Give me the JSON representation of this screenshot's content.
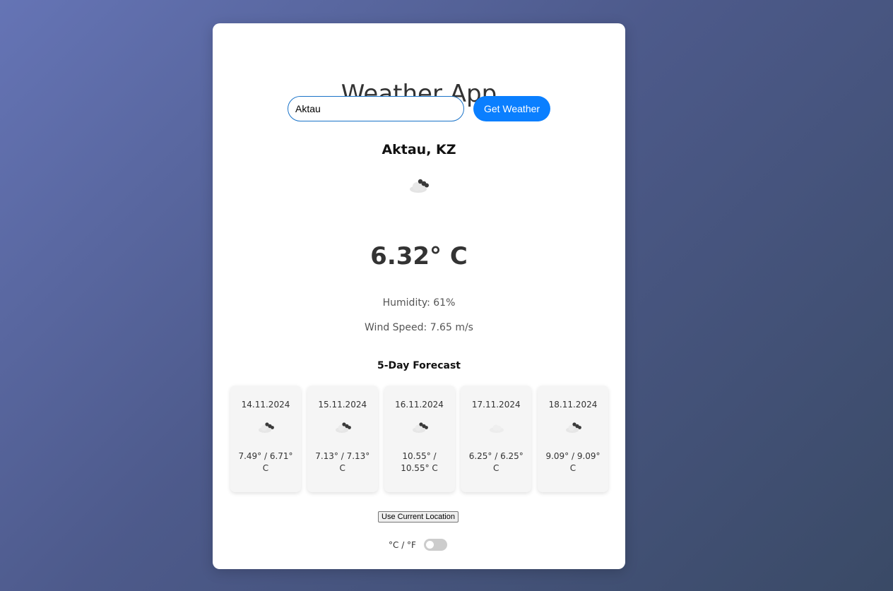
{
  "app": {
    "title": "Weather App"
  },
  "search": {
    "value": "Aktau",
    "button_label": "Get Weather"
  },
  "current": {
    "location": "Aktau, KZ",
    "icon": "cloud-icon",
    "temperature": "6.32° C",
    "humidity": "Humidity: 61%",
    "wind_speed": "Wind Speed: 7.65 m/s"
  },
  "forecast": {
    "title": "5-Day Forecast",
    "days": [
      {
        "date": "14.11.2024",
        "icon": "cloud-icon",
        "temp_line1": "7.49° / 6.71°",
        "temp_line2": "C"
      },
      {
        "date": "15.11.2024",
        "icon": "cloud-icon",
        "temp_line1": "7.13° / 7.13°",
        "temp_line2": "C"
      },
      {
        "date": "16.11.2024",
        "icon": "cloud-icon",
        "temp_line1": "10.55° /",
        "temp_line2": "10.55° C"
      },
      {
        "date": "17.11.2024",
        "icon": "cloud-icon",
        "temp_line1": "6.25° / 6.25°",
        "temp_line2": "C"
      },
      {
        "date": "18.11.2024",
        "icon": "cloud-icon",
        "temp_line1": "9.09° / 9.09°",
        "temp_line2": "C"
      }
    ]
  },
  "controls": {
    "location_button": "Use Current Location",
    "unit_toggle_label": "°C / °F",
    "unit_toggle_on": false
  },
  "colors": {
    "accent": "#0a7fff",
    "input_border": "#1a73c8"
  }
}
